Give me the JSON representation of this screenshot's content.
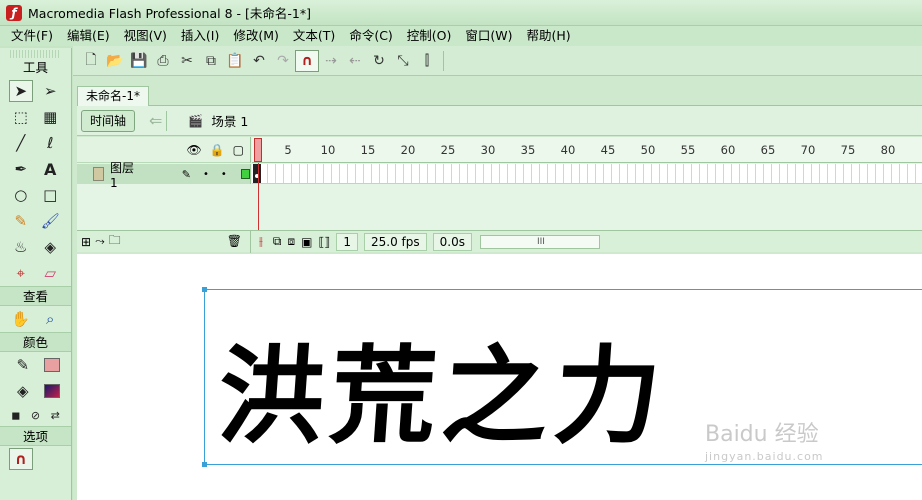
{
  "window": {
    "title": "Macromedia Flash Professional 8 - [未命名-1*]"
  },
  "menu": [
    "文件(F)",
    "编辑(E)",
    "视图(V)",
    "插入(I)",
    "修改(M)",
    "文本(T)",
    "命令(C)",
    "控制(O)",
    "窗口(W)",
    "帮助(H)"
  ],
  "tools": {
    "title": "工具",
    "view_title": "查看",
    "colors_title": "颜色",
    "options_title": "选项",
    "text_tool_glyph": "A"
  },
  "document": {
    "tab_label": "未命名-1*"
  },
  "scene": {
    "timeline_button": "时间轴",
    "scene_label": "场景 1"
  },
  "timeline": {
    "layer_name": "图层 1",
    "ruler_ticks": [
      "5",
      "10",
      "15",
      "20",
      "25",
      "30",
      "35",
      "40",
      "45",
      "50",
      "55",
      "60",
      "65",
      "70",
      "75",
      "80"
    ],
    "current_frame": "1",
    "frame_rate": "25.0 fps",
    "elapsed_time": "0.0s",
    "scroll_grip": "III"
  },
  "stage": {
    "text": "洪荒之力"
  },
  "watermark": {
    "brand": "Baidu 经验",
    "url": "jingyan.baidu.com"
  }
}
